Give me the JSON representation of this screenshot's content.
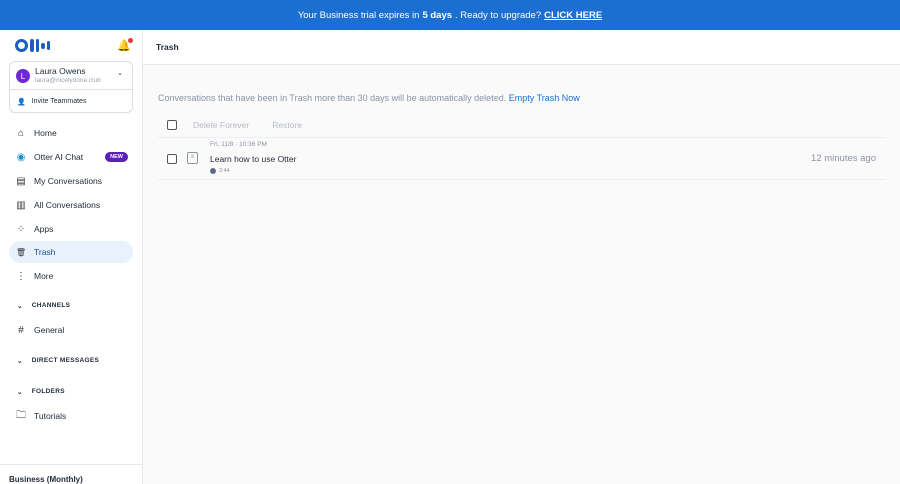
{
  "banner": {
    "prefix": "Your Business trial expires in",
    "days": "5 days",
    "suffix": ". Ready to upgrade?",
    "cta": "CLICK HERE"
  },
  "user": {
    "initial": "L",
    "name": "Laura Owens",
    "email": "laura@nicelydone.club",
    "invite": "Invite Teammates"
  },
  "nav": [
    {
      "label": "Home",
      "icon": "⌂"
    },
    {
      "label": "Otter AI Chat",
      "icon": "◉",
      "badge": "NEW"
    },
    {
      "label": "My Conversations",
      "icon": "▤"
    },
    {
      "label": "All Conversations",
      "icon": "▥"
    },
    {
      "label": "Apps",
      "icon": "⁘"
    },
    {
      "label": "Trash",
      "icon": "🗑"
    },
    {
      "label": "More",
      "icon": "⋮"
    }
  ],
  "sections": {
    "channels": "CHANNELS",
    "general": "General",
    "dm": "DIRECT MESSAGES",
    "folders": "FOLDERS",
    "tutorials": "Tutorials"
  },
  "plan": "Business (Monthly)",
  "page": {
    "title": "Trash",
    "notice": "Conversations that have been in Trash more than 30 days will be automatically deleted.",
    "empty": "Empty Trash Now",
    "delete": "Delete Forever",
    "restore": "Restore"
  },
  "items": [
    {
      "date": "Fri, 11/8 · 10:36 PM",
      "title": "Learn how to use Otter",
      "duration": "3:44",
      "ago": "12 minutes ago"
    }
  ]
}
